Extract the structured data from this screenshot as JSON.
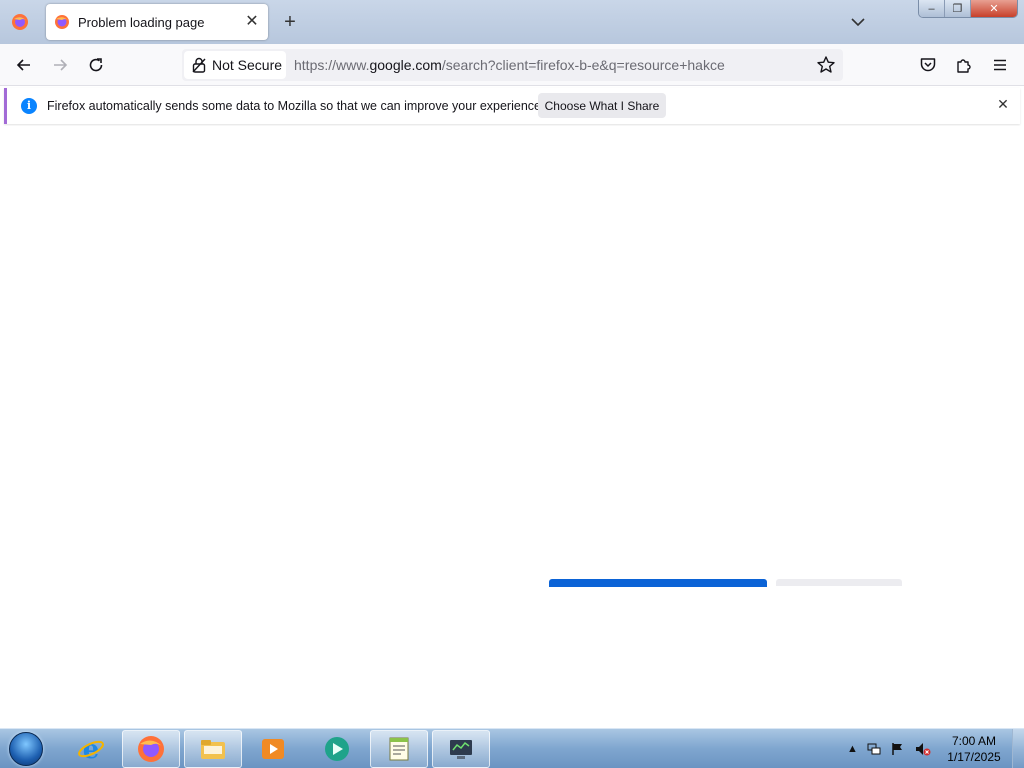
{
  "browser": {
    "tab": {
      "title": "Problem loading page",
      "close": "✕"
    },
    "new_tab": "+",
    "window_controls": {
      "minimize": "–",
      "maximize": "❐",
      "close": "✕"
    }
  },
  "navbar": {
    "security_label": "Not Secure",
    "url_prefix": "https://www.",
    "url_host": "google.com",
    "url_path": "/search?client=firefox-b-e&q=resource+hakce"
  },
  "notification": {
    "icon": "i",
    "message": "Firefox automatically sends some data to Mozilla so that we can improve your experience.",
    "button_label": "Choose What I Share",
    "close": "✕"
  },
  "taskbar": {
    "items": [
      "firefox",
      "internet-explorer",
      "firefox-active",
      "file-explorer",
      "media-player",
      "game",
      "notepad",
      "system-tool"
    ],
    "tray": {
      "expand": "▲"
    },
    "clock": {
      "time": "7:00 AM",
      "date": "1/17/2025"
    }
  },
  "colors": {
    "accent": "#0b63d6",
    "notif_border": "#a26bd6",
    "info_blue": "#0a84ff"
  }
}
